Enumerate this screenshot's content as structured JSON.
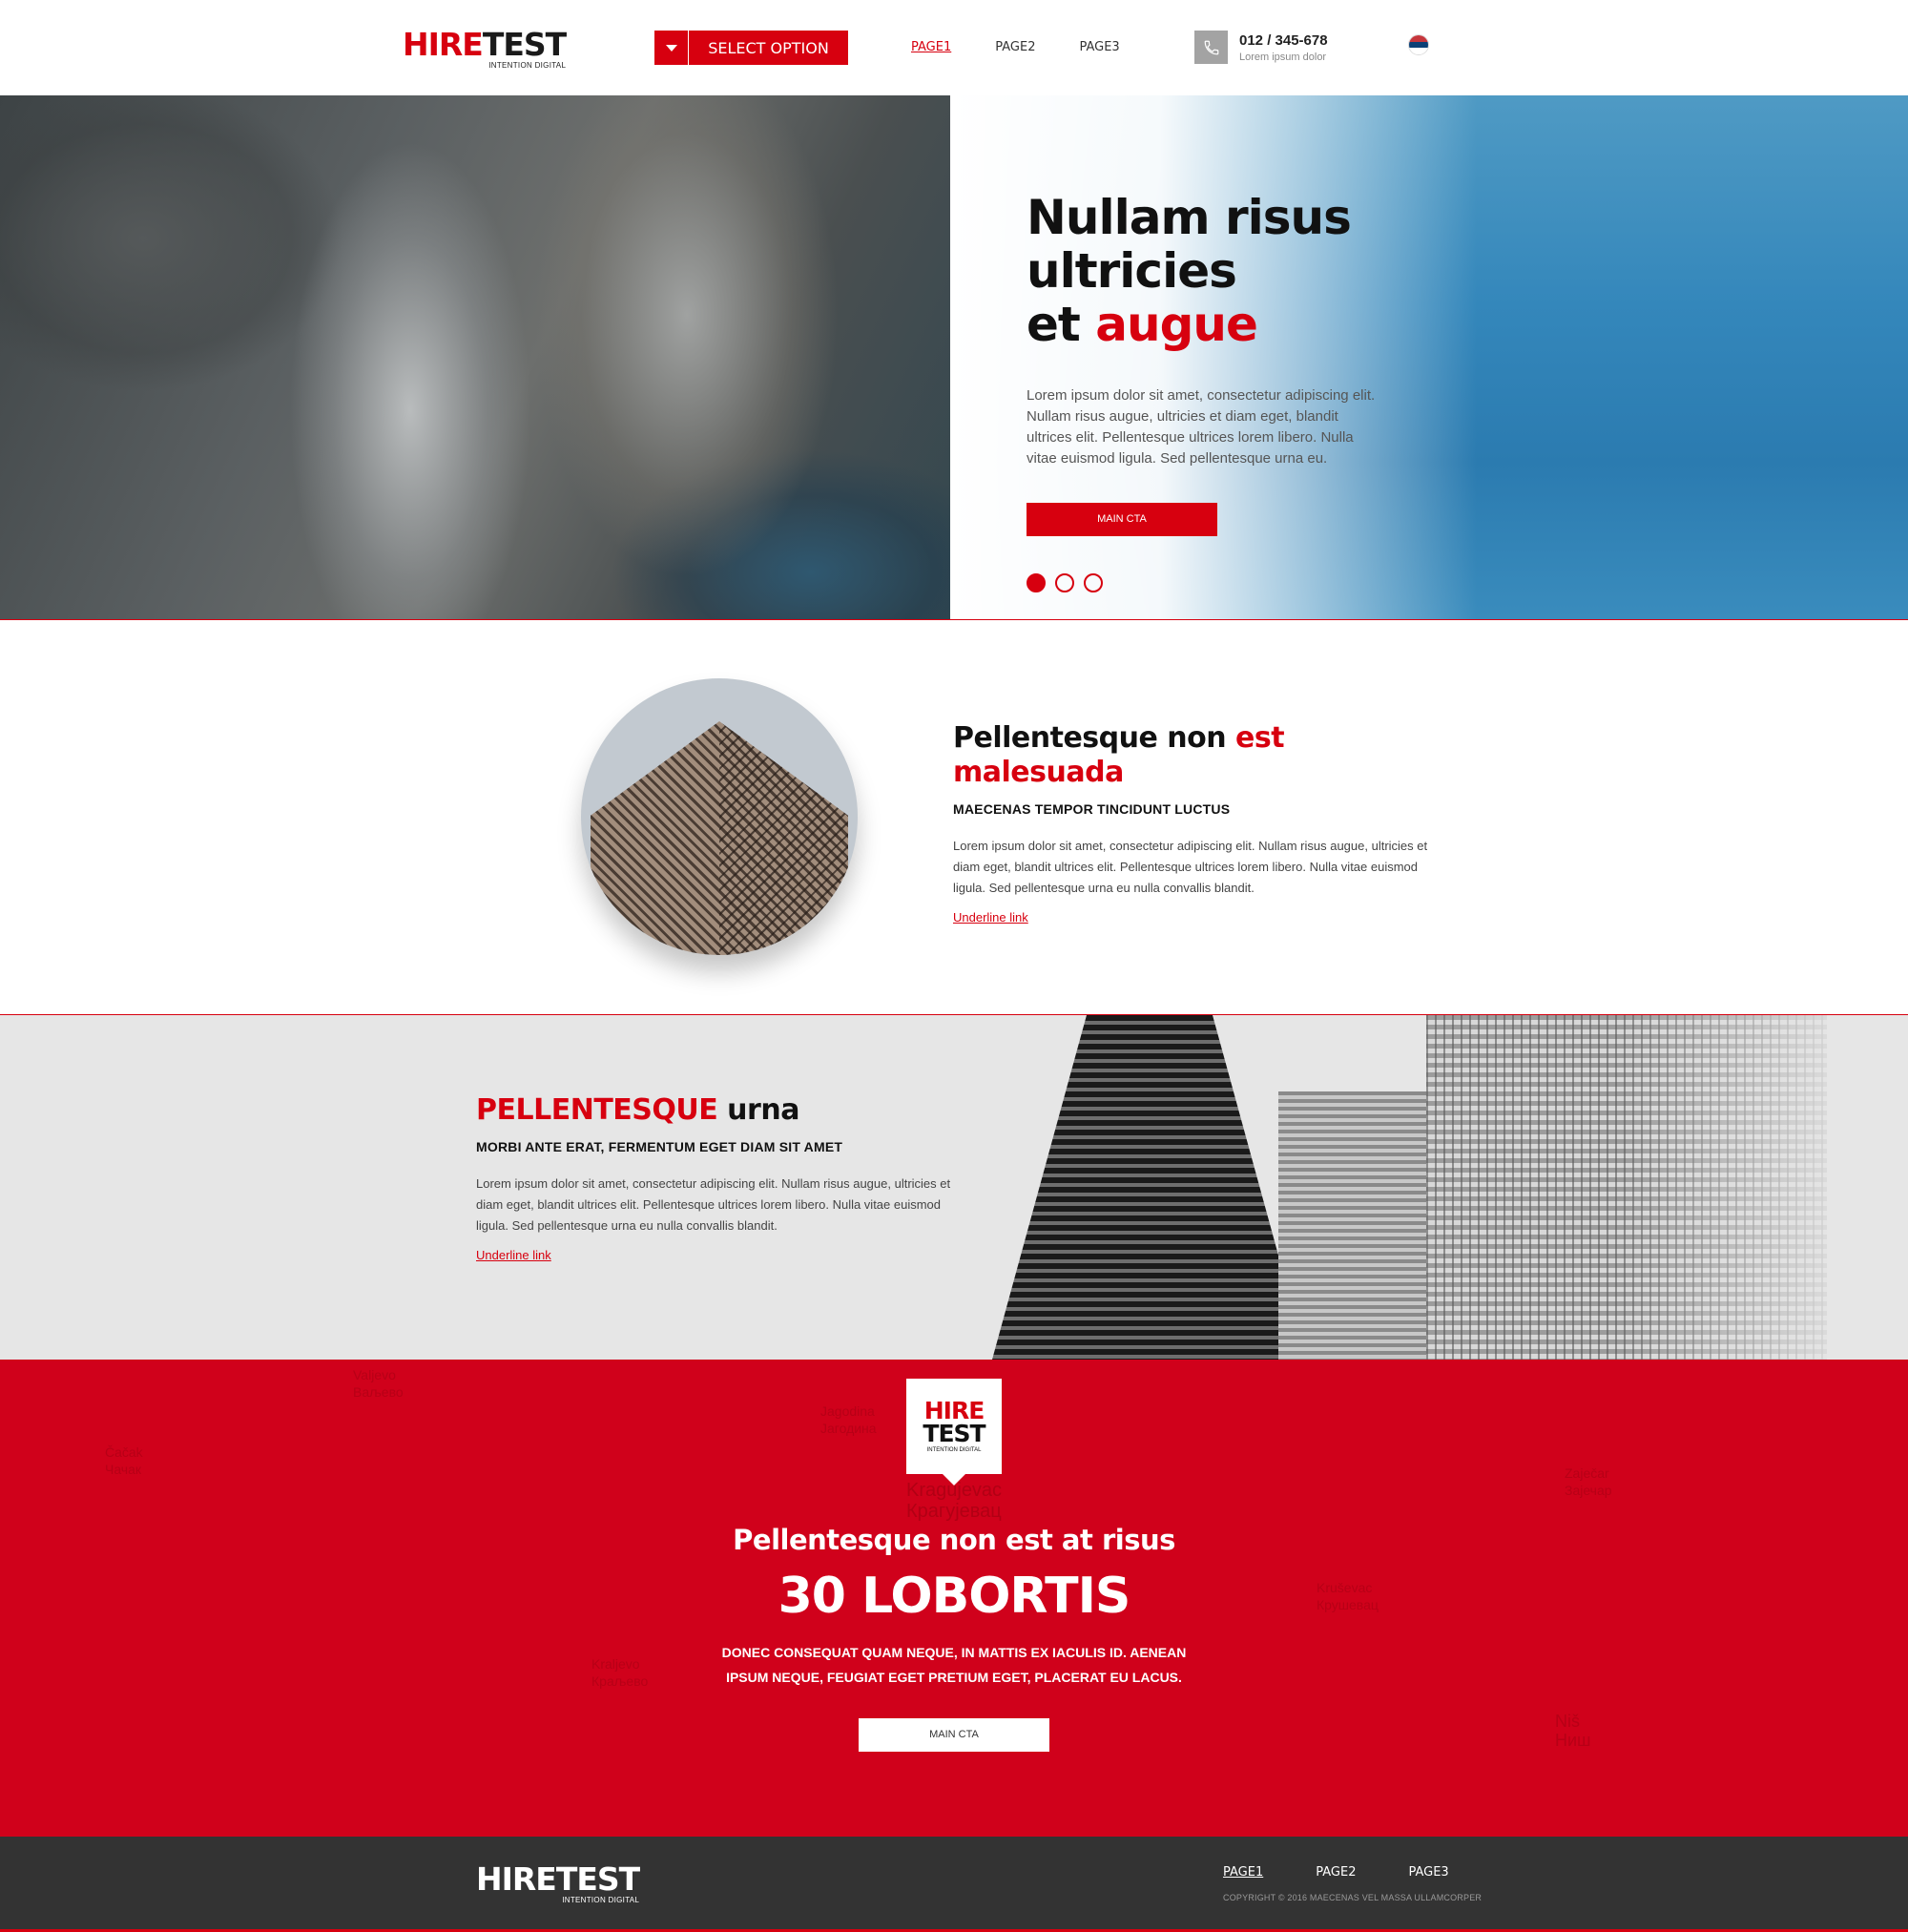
{
  "header": {
    "logo": {
      "hire": "HIRE",
      "test": "TEST",
      "tagline": "INTENTION DIGITAL"
    },
    "select_label": "SELECT OPTION",
    "nav": [
      {
        "label": "PAGE1",
        "active": true
      },
      {
        "label": "PAGE2",
        "active": false
      },
      {
        "label": "PAGE3",
        "active": false
      }
    ],
    "phone": {
      "number": "012 / 345-678",
      "sub": "Lorem ipsum dolor",
      "icon": "phone-icon"
    },
    "flag": {
      "icon": "serbia-flag-icon",
      "colors": [
        "#c6363c",
        "#0c4076",
        "#ffffff"
      ]
    }
  },
  "hero": {
    "title_line1": "Nullam risus ultricies",
    "title_line2_plain": "et ",
    "title_line2_red": "augue",
    "body": "Lorem ipsum dolor sit amet, consectetur adipiscing elit. Nullam risus augue, ultricies et diam eget, blandit ultrices elit. Pellentesque ultrices lorem libero. Nulla vitae euismod ligula. Sed pellentesque urna eu.",
    "cta": "MAIN CTA",
    "slides": 3,
    "active_slide": 1
  },
  "section1": {
    "title_plain": "Pellentesque non ",
    "title_red": "est malesuada",
    "subtitle": "MAECENAS TEMPOR TINCIDUNT LUCTUS",
    "body": "Lorem ipsum dolor sit amet, consectetur adipiscing elit. Nullam risus augue, ultricies et diam eget, blandit ultrices elit. Pellentesque ultrices lorem libero. Nulla vitae euismod ligula. Sed pellentesque urna eu nulla convallis blandit.",
    "link": "Underline link"
  },
  "section2": {
    "title_red": "PELLENTESQUE",
    "title_plain": " urna",
    "subtitle": "MORBI ANTE ERAT, FERMENTUM EGET DIAM SIT AMET",
    "body": "Lorem ipsum dolor sit amet, consectetur adipiscing elit. Nullam risus augue, ultricies et diam eget, blandit ultrices elit. Pellentesque ultrices lorem libero. Nulla vitae euismod ligula. Sed pellentesque urna eu nulla convallis blandit.",
    "link": "Underline link"
  },
  "section3": {
    "badge": {
      "hire": "HIRE",
      "test": "TEST",
      "tagline": "INTENTION DIGITAL"
    },
    "title": "Pellentesque non est at risus",
    "big": "30 LOBORTIS",
    "body": "DONEC CONSEQUAT QUAM NEQUE, IN MATTIS EX IACULIS ID. AENEAN IPSUM NEQUE, FEUGIAT EGET PRETIUM EGET, PLACERAT EU LACUS.",
    "cta": "MAIN CTA",
    "map_labels": [
      "Kragujevac",
      "Крагујевац",
      "Jagodina",
      "Јагодина",
      "Zaječar",
      "Зајечар",
      "Kraljevo",
      "Краљево",
      "Čačak",
      "Чачак",
      "Kruševac",
      "Крушевац",
      "Niš",
      "Ниш",
      "Valjevo",
      "Ваљево"
    ]
  },
  "footer": {
    "logo": {
      "text": "HIRETEST",
      "tagline": "INTENTION DIGITAL"
    },
    "nav": [
      {
        "label": "PAGE1",
        "active": true
      },
      {
        "label": "PAGE2",
        "active": false
      },
      {
        "label": "PAGE3",
        "active": false
      }
    ],
    "copyright": "COPYRIGHT © 2016 MAECENAS VEL MASSA ULLAMCORPER"
  },
  "colors": {
    "accent": "#d7000f",
    "footer_bg": "#333333",
    "section_gray": "#e6e6e6"
  }
}
